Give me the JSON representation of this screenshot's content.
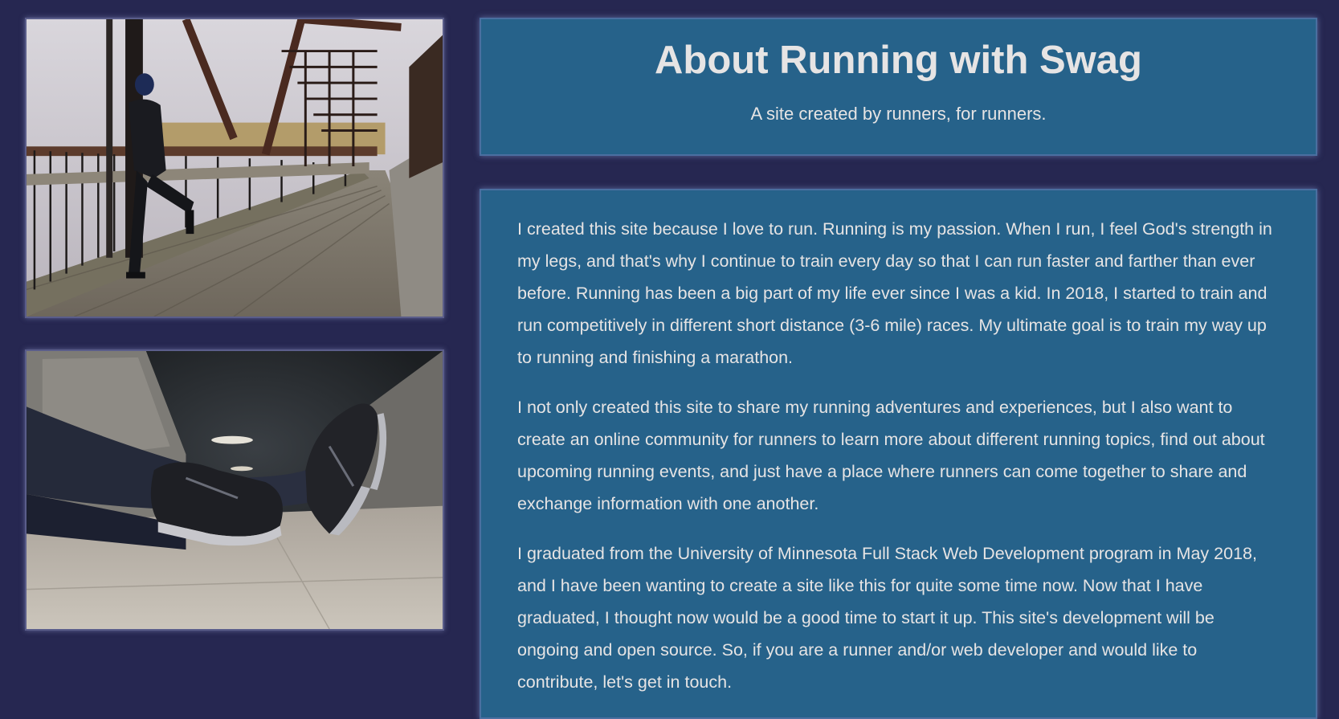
{
  "images": {
    "bridge_photo_label": "runner stretching on a bridge",
    "shoes_photo_label": "running shoes in a tunnel"
  },
  "header": {
    "title": "About Running with Swag",
    "subtitle": "A site created by runners, for runners."
  },
  "about": {
    "paragraphs": [
      "I created this site because I love to run. Running is my passion. When I run, I feel God's strength in my legs, and that's why I continue to train every day so that I can run faster and farther than ever before. Running has been a big part of my life ever since I was a kid. In 2018, I started to train and run competitively in different short distance (3-6 mile) races. My ultimate goal is to train my way up to running and finishing a marathon.",
      "I not only created this site to share my running adventures and experiences, but I also want to create an online community for runners to learn more about different running topics, find out about upcoming running events, and just have a place where runners can come together to share and exchange information with one another.",
      "I graduated from the University of Minnesota Full Stack Web Development program in May 2018, and I have been wanting to create a site like this for quite some time now. Now that I have graduated, I thought now would be a good time to start it up. This site's development will be ongoing and open source. So, if you are a runner and/or web developer and would like to contribute, let's get in touch."
    ]
  },
  "colors": {
    "page_background": "#262751",
    "panel_background": "#26628a",
    "text": "#e6e4e4"
  }
}
